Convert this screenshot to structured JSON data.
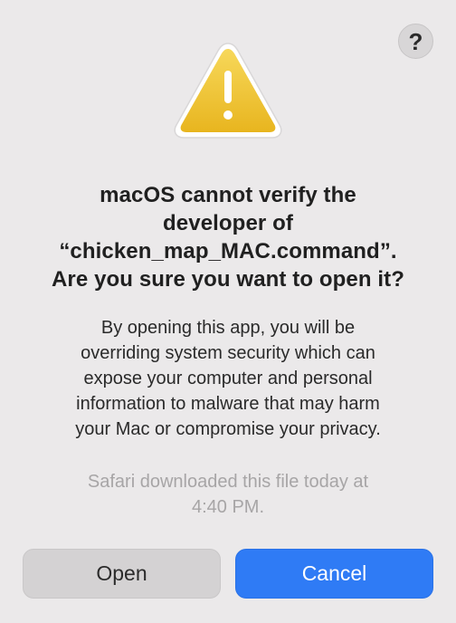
{
  "help": {
    "label": "?"
  },
  "title_lines": [
    "macOS cannot verify the",
    "developer of",
    "“chicken_map_MAC.command”.",
    "Are you sure you want to open it?"
  ],
  "message_lines": [
    "By opening this app, you will be",
    "overriding system security which can",
    "expose your computer and personal",
    "information to malware that may harm",
    "your Mac or compromise your privacy."
  ],
  "source_lines": [
    "Safari downloaded this file today at",
    "4:40 PM."
  ],
  "buttons": {
    "open_label": "Open",
    "cancel_label": "Cancel"
  },
  "colors": {
    "background": "#ebe9ea",
    "warning_yellow": "#f3c93a",
    "accent_blue": "#2f7bf5",
    "secondary_text": "#a7a5a6"
  },
  "icons": {
    "warning": "warning-triangle-icon",
    "help": "question-mark-icon"
  }
}
